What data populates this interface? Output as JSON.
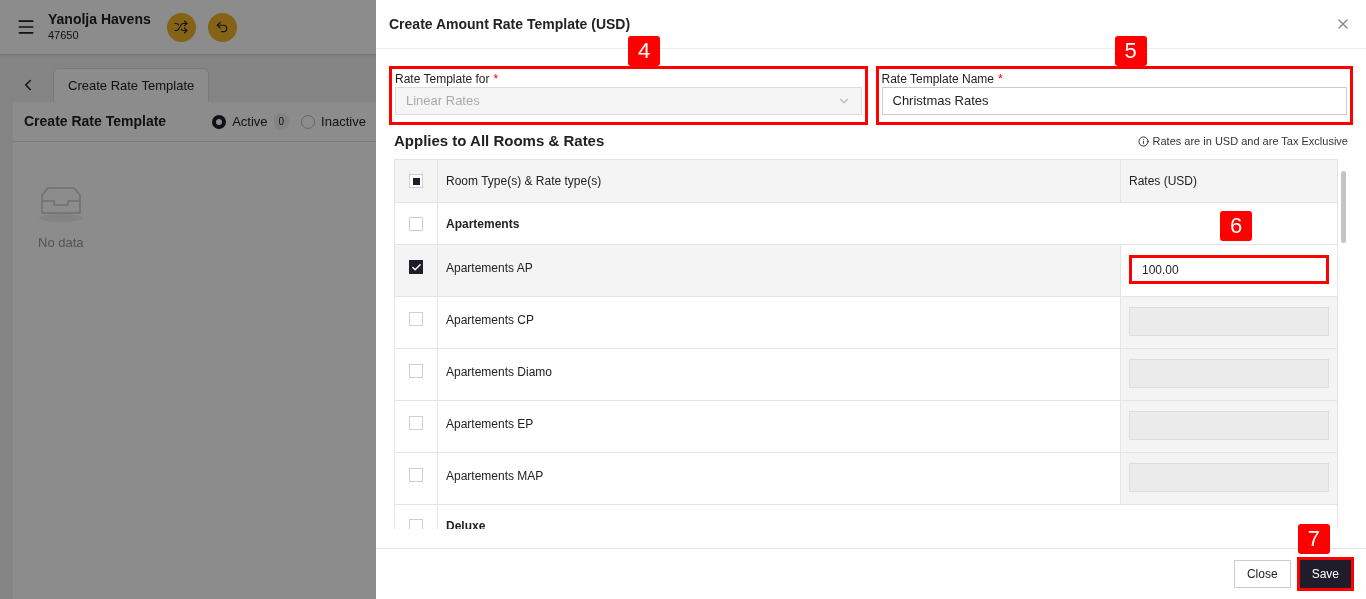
{
  "app": {
    "hotel_name": "Yanolja Havens",
    "hotel_code": "47650"
  },
  "page": {
    "tab": "Create Rate Template",
    "heading": "Create Rate Template",
    "filters": [
      {
        "label": "Active",
        "count": "0",
        "selected": true
      },
      {
        "label": "Inactive",
        "selected": false
      }
    ],
    "empty_text": "No data"
  },
  "drawer": {
    "title": "Create Amount Rate Template (USD)",
    "fields": [
      {
        "kind": "select",
        "label": "Rate Template for",
        "required_mark": "*",
        "value": "Linear Rates",
        "disabled": true,
        "callout": "4"
      },
      {
        "kind": "text",
        "label": "Rate Template Name",
        "required_mark": "*",
        "value": "Christmas Rates",
        "disabled": false,
        "callout": "5"
      }
    ],
    "section_title": "Applies to All Rooms & Rates",
    "note": "Rates are in USD and are Tax Exclusive",
    "table": {
      "columns": [
        "Room Type(s) & Rate type(s)",
        "Rates (USD)"
      ],
      "header_indeterminate": true,
      "rows": [
        {
          "kind": "group",
          "label": "Apartements",
          "checked": false
        },
        {
          "kind": "rate",
          "label": "Apartements AP",
          "checked": true,
          "rate": "100.00",
          "callout": "6"
        },
        {
          "kind": "rate",
          "label": "Apartements CP",
          "checked": false
        },
        {
          "kind": "rate",
          "label": "Apartements Diamo",
          "checked": false
        },
        {
          "kind": "rate",
          "label": "Apartements EP",
          "checked": false
        },
        {
          "kind": "rate",
          "label": "Apartements MAP",
          "checked": false
        },
        {
          "kind": "group",
          "label": "Deluxe",
          "checked": false
        }
      ]
    },
    "buttons": [
      {
        "kind": "secondary",
        "label": "Close"
      },
      {
        "kind": "primary",
        "label": "Save",
        "callout": "7"
      }
    ]
  }
}
